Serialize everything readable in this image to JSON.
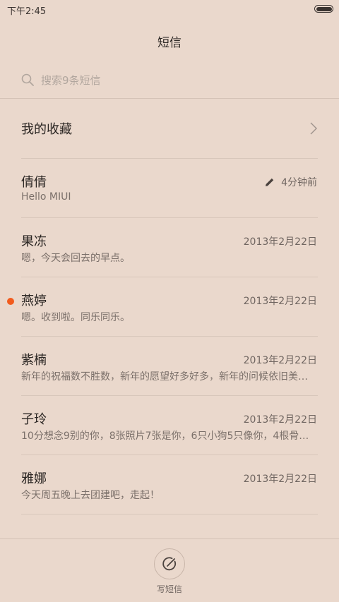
{
  "status_bar": {
    "time": "下午2:45",
    "battery_icon": "battery-icon"
  },
  "header": {
    "title": "短信"
  },
  "search": {
    "icon": "search-icon",
    "placeholder": "搜索9条短信"
  },
  "favorites": {
    "label": "我的收藏",
    "icon": "chevron-right-icon"
  },
  "conversations": [
    {
      "name": "倩倩",
      "preview": "Hello MIUI",
      "time": "4分钟前",
      "draft": true,
      "unread": false
    },
    {
      "name": "果冻",
      "preview": "嗯，今天会回去的早点。",
      "time": "2013年2月22日",
      "draft": false,
      "unread": false
    },
    {
      "name": "燕婷",
      "preview": "嗯。收到啦。同乐同乐。",
      "time": "2013年2月22日",
      "draft": false,
      "unread": true
    },
    {
      "name": "紫楠",
      "preview": "新年的祝福数不胜数，新年的愿望好多好多，新年的问候依旧美…",
      "time": "2013年2月22日",
      "draft": false,
      "unread": false
    },
    {
      "name": "子玲",
      "preview": "10分想念9别的你，8张照片7张是你，6只小狗5只像你，4根骨…",
      "time": "2013年2月22日",
      "draft": false,
      "unread": false
    },
    {
      "name": "雅娜",
      "preview": "今天周五晚上去团建吧，走起！",
      "time": "2013年2月22日",
      "draft": false,
      "unread": false
    }
  ],
  "compose": {
    "label": "写短信",
    "icon": "compose-icon"
  },
  "colors": {
    "background": "#ead8cc",
    "unread_dot": "#f25b1d",
    "text_primary": "#2b2623",
    "text_secondary": "#7b706a"
  }
}
